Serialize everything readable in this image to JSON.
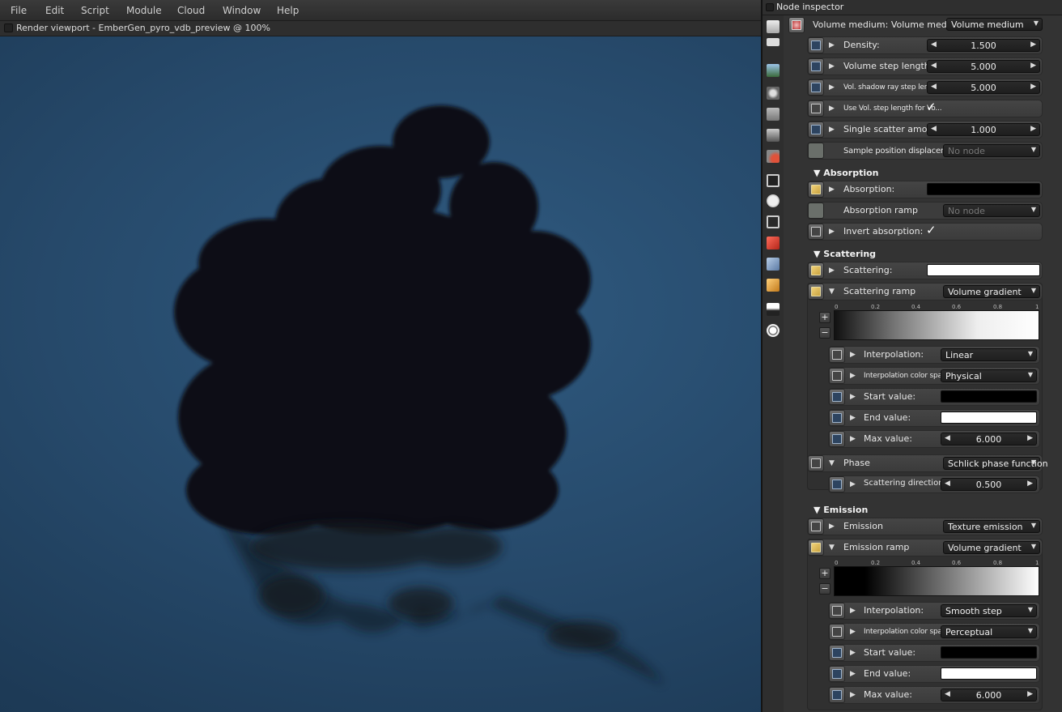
{
  "menu": [
    "File",
    "Edit",
    "Script",
    "Module",
    "Cloud",
    "Window",
    "Help"
  ],
  "viewport": {
    "title": "Render viewport - EmberGen_pyro_vdb_preview @ 100%"
  },
  "inspector": {
    "title": "Node inspector",
    "node_label": "Volume medium: Volume medium",
    "node_type": "Volume medium",
    "props": {
      "density": {
        "label": "Density:",
        "value": "1.500"
      },
      "vol_step": {
        "label": "Volume step length:",
        "value": "5.000"
      },
      "shadow_step": {
        "label": "Vol. shadow ray step length:",
        "value": "5.000"
      },
      "use_vol_step": {
        "label": "Use Vol. step length for Vo..."
      },
      "single_scatter": {
        "label": "Single scatter amount:",
        "value": "1.000"
      },
      "sample_disp": {
        "label": "Sample position displacement",
        "value": "No node"
      }
    },
    "absorption": {
      "section": "Absorption",
      "color_label": "Absorption:",
      "ramp_label": "Absorption ramp",
      "ramp_value": "No node",
      "invert_label": "Invert absorption:"
    },
    "scattering": {
      "section": "Scattering",
      "color_label": "Scattering:",
      "ramp_label": "Scattering ramp",
      "ramp_value": "Volume gradient",
      "ticks": [
        "0",
        "0.2",
        "0.4",
        "0.6",
        "0.8",
        "1"
      ],
      "interp_label": "Interpolation:",
      "interp_value": "Linear",
      "space_label": "Interpolation color space:",
      "space_value": "Physical",
      "start_label": "Start value:",
      "end_label": "End value:",
      "max_label": "Max value:",
      "max_value": "6.000",
      "phase_label": "Phase",
      "phase_value": "Schlick phase function",
      "dir_label": "Scattering direction:",
      "dir_value": "0.500"
    },
    "emission": {
      "section": "Emission",
      "emission_label": "Emission",
      "emission_value": "Texture emission",
      "ramp_label": "Emission ramp",
      "ramp_value": "Volume gradient",
      "ticks": [
        "0",
        "0.2",
        "0.4",
        "0.6",
        "0.8",
        "1"
      ],
      "interp_label": "Interpolation:",
      "interp_value": "Smooth step",
      "space_label": "Interpolation color space:",
      "space_value": "Perceptual",
      "start_label": "Start value:",
      "end_label": "End value:",
      "max_label": "Max value:",
      "max_value": "6.000"
    }
  },
  "strip_icons": [
    "layers-icon",
    "list-icon",
    "picture-icon",
    "camera-icon",
    "database-icon",
    "geometry-icon",
    "material-icon",
    "texture-icon",
    "clock-icon",
    "network-icon",
    "red-cube-icon",
    "blue-cube-icon",
    "orange-cube-icon",
    "image-icon",
    "sun-icon"
  ],
  "colors": {
    "sky": "#26496a",
    "panel": "#333333",
    "accent": "#9fb4cc"
  }
}
